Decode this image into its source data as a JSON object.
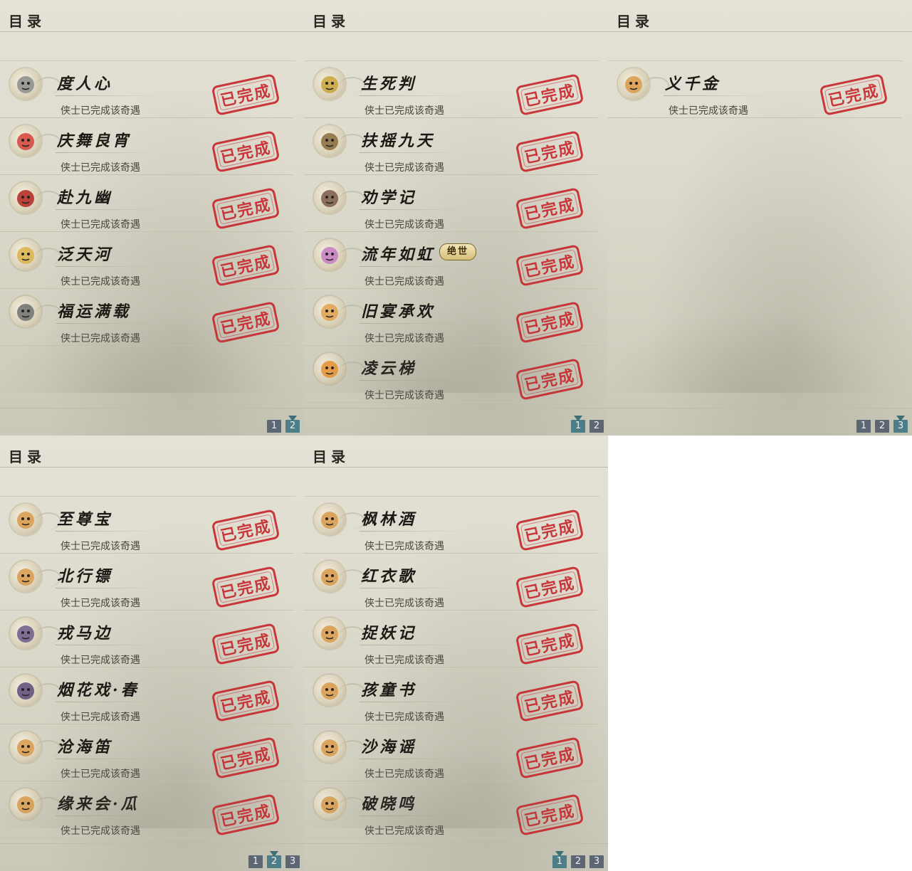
{
  "panels": [
    {
      "title": "目录",
      "entries": [
        {
          "name": "度人心",
          "status": "侠士已完成该奇遇",
          "stamp": "已完成",
          "icon": "mask-icon"
        },
        {
          "name": "庆舞良宵",
          "status": "侠士已完成该奇遇",
          "stamp": "已完成",
          "icon": "lion-dance-icon"
        },
        {
          "name": "赴九幽",
          "status": "侠士已完成该奇遇",
          "stamp": "已完成",
          "icon": "red-tree-icon"
        },
        {
          "name": "泛天河",
          "status": "侠士已完成该奇遇",
          "stamp": "已完成",
          "icon": "golden-mask-icon"
        },
        {
          "name": "福运满载",
          "status": "侠士已完成该奇遇",
          "stamp": "已完成",
          "icon": "husky-dog-icon"
        }
      ],
      "pager": [
        "1",
        "2"
      ],
      "active_page": "2"
    },
    {
      "title": "目录",
      "entries": [
        {
          "name": "生死判",
          "status": "侠士已完成该奇遇",
          "stamp": "已完成",
          "icon": "gold-ingot-icon"
        },
        {
          "name": "扶摇九天",
          "status": "侠士已完成该奇遇",
          "stamp": "已完成",
          "icon": "wooden-post-icon"
        },
        {
          "name": "劝学记",
          "status": "侠士已完成该奇遇",
          "stamp": "已完成",
          "icon": "paw-icon"
        },
        {
          "name": "流年如虹",
          "status": "侠士已完成该奇遇",
          "stamp": "已完成",
          "icon": "flower-icon",
          "badge": "绝世"
        },
        {
          "name": "旧宴承欢",
          "status": "侠士已完成该奇遇",
          "stamp": "已完成",
          "icon": "thumbs-up-icon"
        },
        {
          "name": "凌云梯",
          "status": "侠士已完成该奇遇",
          "stamp": "已完成",
          "icon": "face-icon"
        }
      ],
      "pager": [
        "1",
        "2"
      ],
      "active_page": "1"
    },
    {
      "title": "目录",
      "entries": [
        {
          "name": "义千金",
          "status": "侠士已完成该奇遇",
          "stamp": "已完成",
          "icon": "cat-icon"
        }
      ],
      "pager": [
        "1",
        "2",
        "3"
      ],
      "active_page": "3"
    },
    {
      "title": "目录",
      "entries": [
        {
          "name": "至尊宝",
          "status": "侠士已完成该奇遇",
          "stamp": "已完成",
          "icon": "cat-icon"
        },
        {
          "name": "北行镖",
          "status": "侠士已完成该奇遇",
          "stamp": "已完成",
          "icon": "cat-icon"
        },
        {
          "name": "戎马边",
          "status": "侠士已完成该奇遇",
          "stamp": "已完成",
          "icon": "warrior-portrait-icon"
        },
        {
          "name": "烟花戏·春",
          "status": "侠士已完成该奇遇",
          "stamp": "已完成",
          "icon": "lady-portrait-icon"
        },
        {
          "name": "沧海笛",
          "status": "侠士已完成该奇遇",
          "stamp": "已完成",
          "icon": "cat-icon"
        },
        {
          "name": "缘来会·瓜",
          "status": "侠士已完成该奇遇",
          "stamp": "已完成",
          "icon": "cat-icon"
        }
      ],
      "pager": [
        "1",
        "2",
        "3"
      ],
      "active_page": "2"
    },
    {
      "title": "目录",
      "entries": [
        {
          "name": "枫林酒",
          "status": "侠士已完成该奇遇",
          "stamp": "已完成",
          "icon": "cat-icon"
        },
        {
          "name": "红衣歌",
          "status": "侠士已完成该奇遇",
          "stamp": "已完成",
          "icon": "cat-icon"
        },
        {
          "name": "捉妖记",
          "status": "侠士已完成该奇遇",
          "stamp": "已完成",
          "icon": "cat-icon"
        },
        {
          "name": "孩童书",
          "status": "侠士已完成该奇遇",
          "stamp": "已完成",
          "icon": "cat-icon"
        },
        {
          "name": "沙海谣",
          "status": "侠士已完成该奇遇",
          "stamp": "已完成",
          "icon": "cat-icon"
        },
        {
          "name": "破晓鸣",
          "status": "侠士已完成该奇遇",
          "stamp": "已完成",
          "icon": "cat-icon"
        }
      ],
      "pager": [
        "1",
        "2",
        "3"
      ],
      "active_page": "1"
    }
  ],
  "colors": {
    "stamp": "#c8252a",
    "page_button": "#5c6773",
    "page_button_active": "#4d7d86"
  }
}
